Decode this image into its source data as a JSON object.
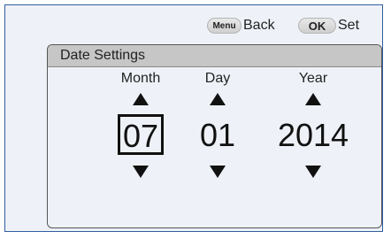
{
  "topbar": {
    "back_key": "Menu",
    "back_label": "Back",
    "set_key": "OK",
    "set_label": "Set"
  },
  "panel": {
    "title": "Date Settings",
    "fields": [
      {
        "label": "Month",
        "value": "07",
        "selected": true
      },
      {
        "label": "Day",
        "value": "01",
        "selected": false
      },
      {
        "label": "Year",
        "value": "2014",
        "selected": false
      }
    ]
  }
}
